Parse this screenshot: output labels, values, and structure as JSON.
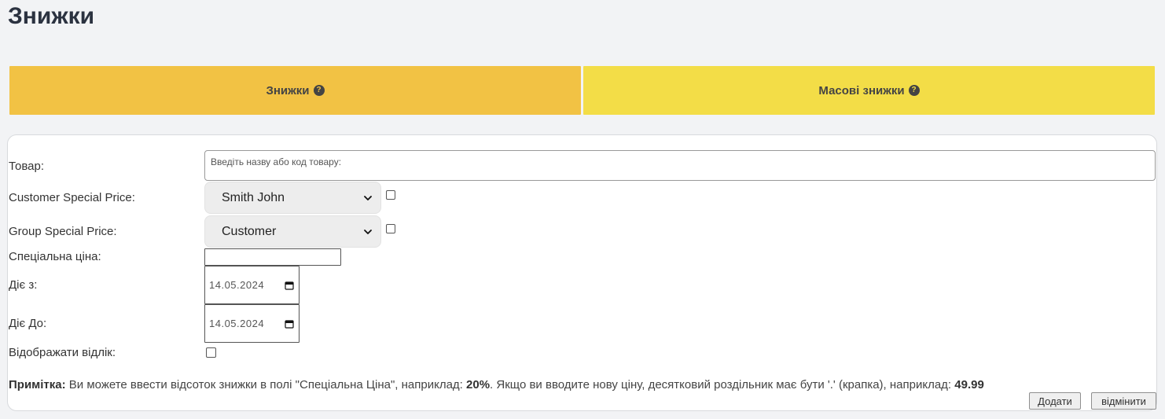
{
  "page": {
    "title": "Знижки"
  },
  "tabs": [
    {
      "label": "Знижки",
      "icon": "question-circle-icon",
      "active": true
    },
    {
      "label": "Масові знижки",
      "icon": "question-circle-icon",
      "active": false
    }
  ],
  "form": {
    "product_label": "Товар:",
    "product_placeholder": "Введіть назву або код товару:",
    "customer_price_label": "Customer Special Price:",
    "customer_select_value": "Smith John",
    "group_price_label": "Group Special Price:",
    "group_select_value": "Customer",
    "special_price_label": "Спеціальна ціна:",
    "special_price_value": "",
    "valid_from_label": "Діє з:",
    "valid_from_value": "14.05.2024",
    "valid_to_label": "Діє До:",
    "valid_to_value": "14.05.2024",
    "show_countdown_label": "Відображати відлік:"
  },
  "note": {
    "bold_prefix": "Примітка:",
    "text_1": " Ви можете ввести відсоток знижки в полі \"Спеціальна Ціна\", наприклад: ",
    "example_percent": "20%",
    "text_2": ". Якщо ви вводите нову ціну, десятковий роздільник має бути '.' (крапка), наприклад: ",
    "example_price": "49.99"
  },
  "buttons": {
    "add": "Додати",
    "cancel": "відмінити"
  },
  "colors": {
    "tab_active": "#f2c244",
    "tab_inactive": "#f3dd47",
    "background": "#f2f3f5"
  }
}
